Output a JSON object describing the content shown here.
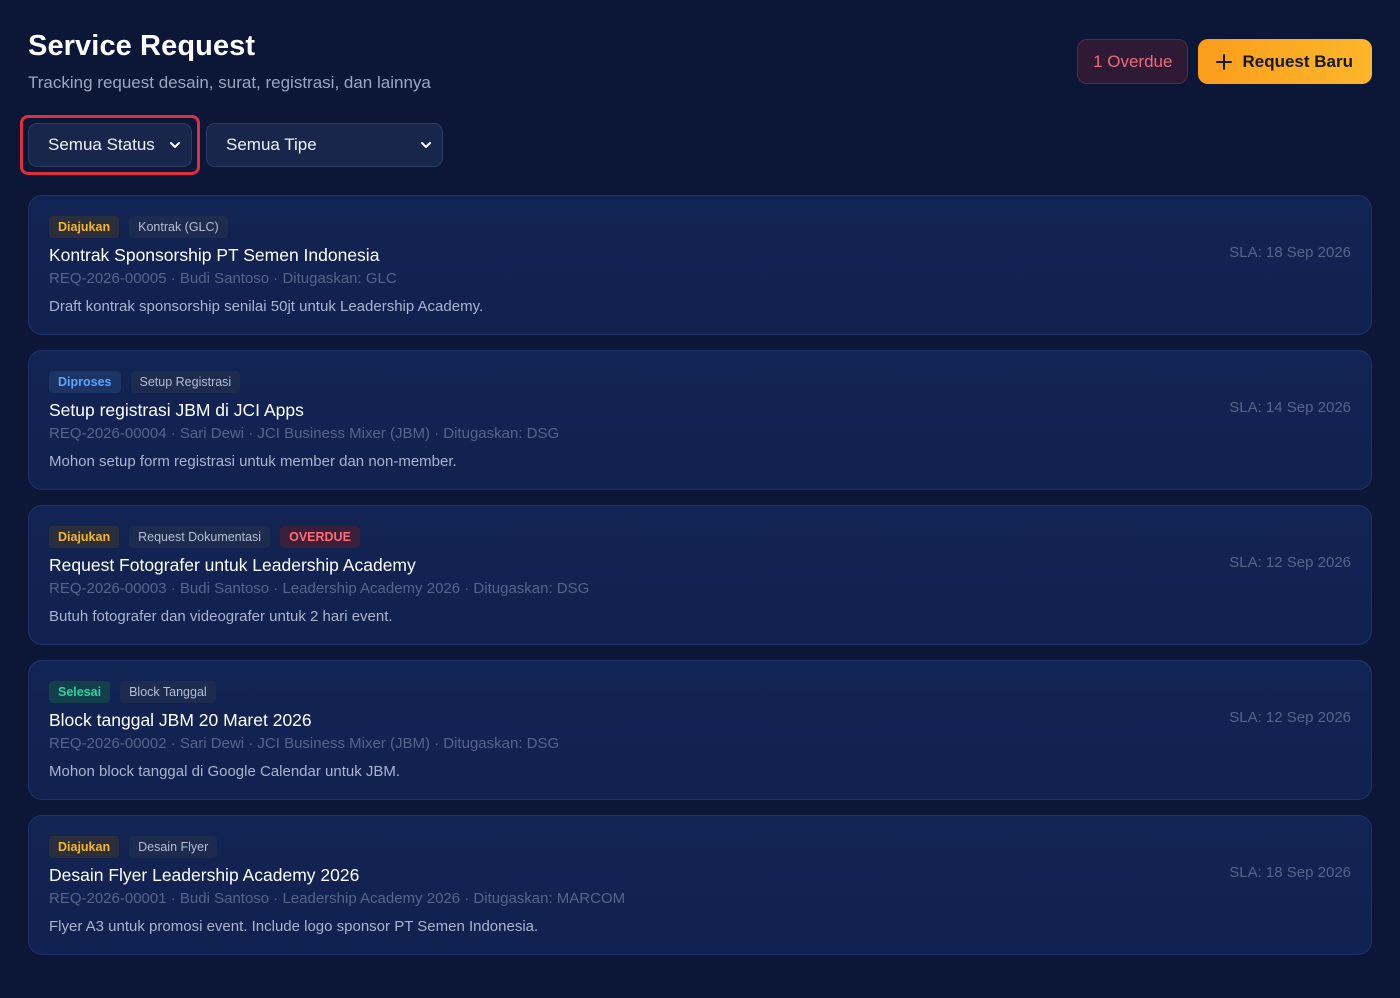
{
  "header": {
    "title": "Service Request",
    "subtitle": "Tracking request desain, surat, registrasi, dan lainnya",
    "overdue_label": "1 Overdue",
    "new_request_label": "Request Baru"
  },
  "filters": {
    "status": {
      "value": "Semua Status"
    },
    "type": {
      "value": "Semua Tipe"
    }
  },
  "colors": {
    "background": "#0c1738",
    "card": "#122453",
    "accent": "#fdb62a",
    "overdue": "#f06a7a",
    "focus_ring": "#e02f3c"
  },
  "requests": [
    {
      "status": "Diajukan",
      "type": "Kontrak (GLC)",
      "overdue": "",
      "title": "Kontrak Sponsorship PT Semen Indonesia",
      "meta": "REQ-2026-00005 · Budi Santoso · Ditugaskan: GLC",
      "description": "Draft kontrak sponsorship senilai 50jt untuk Leadership Academy.",
      "sla": "SLA: 18 Sep 2026"
    },
    {
      "status": "Diproses",
      "type": "Setup Registrasi",
      "overdue": "",
      "title": "Setup registrasi JBM di JCI Apps",
      "meta": "REQ-2026-00004 · Sari Dewi · JCI Business Mixer (JBM) · Ditugaskan: DSG",
      "description": "Mohon setup form registrasi untuk member dan non-member.",
      "sla": "SLA: 14 Sep 2026"
    },
    {
      "status": "Diajukan",
      "type": "Request Dokumentasi",
      "overdue": "OVERDUE",
      "title": "Request Fotografer untuk Leadership Academy",
      "meta": "REQ-2026-00003 · Budi Santoso · Leadership Academy 2026 · Ditugaskan: DSG",
      "description": "Butuh fotografer dan videografer untuk 2 hari event.",
      "sla": "SLA: 12 Sep 2026"
    },
    {
      "status": "Selesai",
      "type": "Block Tanggal",
      "overdue": "",
      "title": "Block tanggal JBM 20 Maret 2026",
      "meta": "REQ-2026-00002 · Sari Dewi · JCI Business Mixer (JBM) · Ditugaskan: DSG",
      "description": "Mohon block tanggal di Google Calendar untuk JBM.",
      "sla": "SLA: 12 Sep 2026"
    },
    {
      "status": "Diajukan",
      "type": "Desain Flyer",
      "overdue": "",
      "title": "Desain Flyer Leadership Academy 2026",
      "meta": "REQ-2026-00001 · Budi Santoso · Leadership Academy 2026 · Ditugaskan: MARCOM",
      "description": "Flyer A3 untuk promosi event. Include logo sponsor PT Semen Indonesia.",
      "sla": "SLA: 18 Sep 2026"
    }
  ]
}
